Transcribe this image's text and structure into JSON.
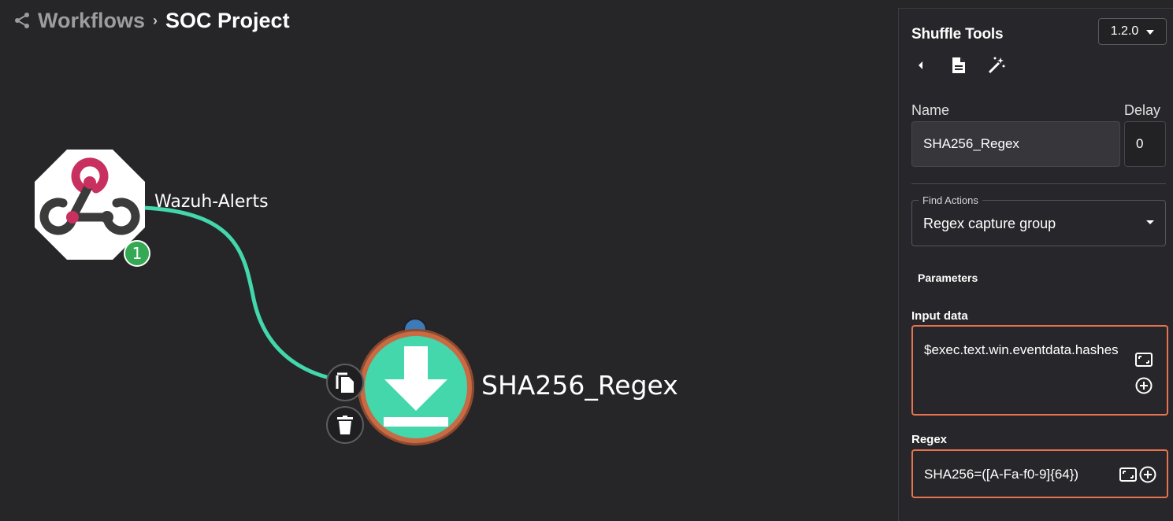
{
  "breadcrumb": {
    "icon": "share-nodes-icon",
    "parent": "Workflows",
    "separator": "›",
    "current": "SOC Project"
  },
  "canvas": {
    "trigger": {
      "label": "Wazuh-Alerts",
      "icon": "webhook-icon",
      "badge": "1",
      "badge_color": "#34a853"
    },
    "action": {
      "label": "SHA256_Regex",
      "icon": "download-icon",
      "fill_color": "#43d7ab",
      "ring_color": "#c86a43"
    },
    "edge_color": "#43d7ab",
    "start_dot_color": "#3c7ab8",
    "tools": [
      "copy-icon",
      "trash-icon"
    ]
  },
  "panel": {
    "title": "Shuffle Tools",
    "version": "1.2.0",
    "toolbar_icons": [
      "chevron-left-icon",
      "document-icon",
      "magic-wand-icon"
    ],
    "name_label": "Name",
    "name_value": "SHA256_Regex",
    "delay_label": "Delay",
    "delay_value": "0",
    "find_actions_label": "Find Actions",
    "find_actions_value": "Regex capture group",
    "parameters_label": "Parameters",
    "params": [
      {
        "label": "Input data",
        "value": "$exec.text.win.eventdata.hashes"
      },
      {
        "label": "Regex",
        "value": "SHA256=([A-Fa-f0-9]{64})"
      }
    ],
    "accent_color": "#e8744f"
  }
}
